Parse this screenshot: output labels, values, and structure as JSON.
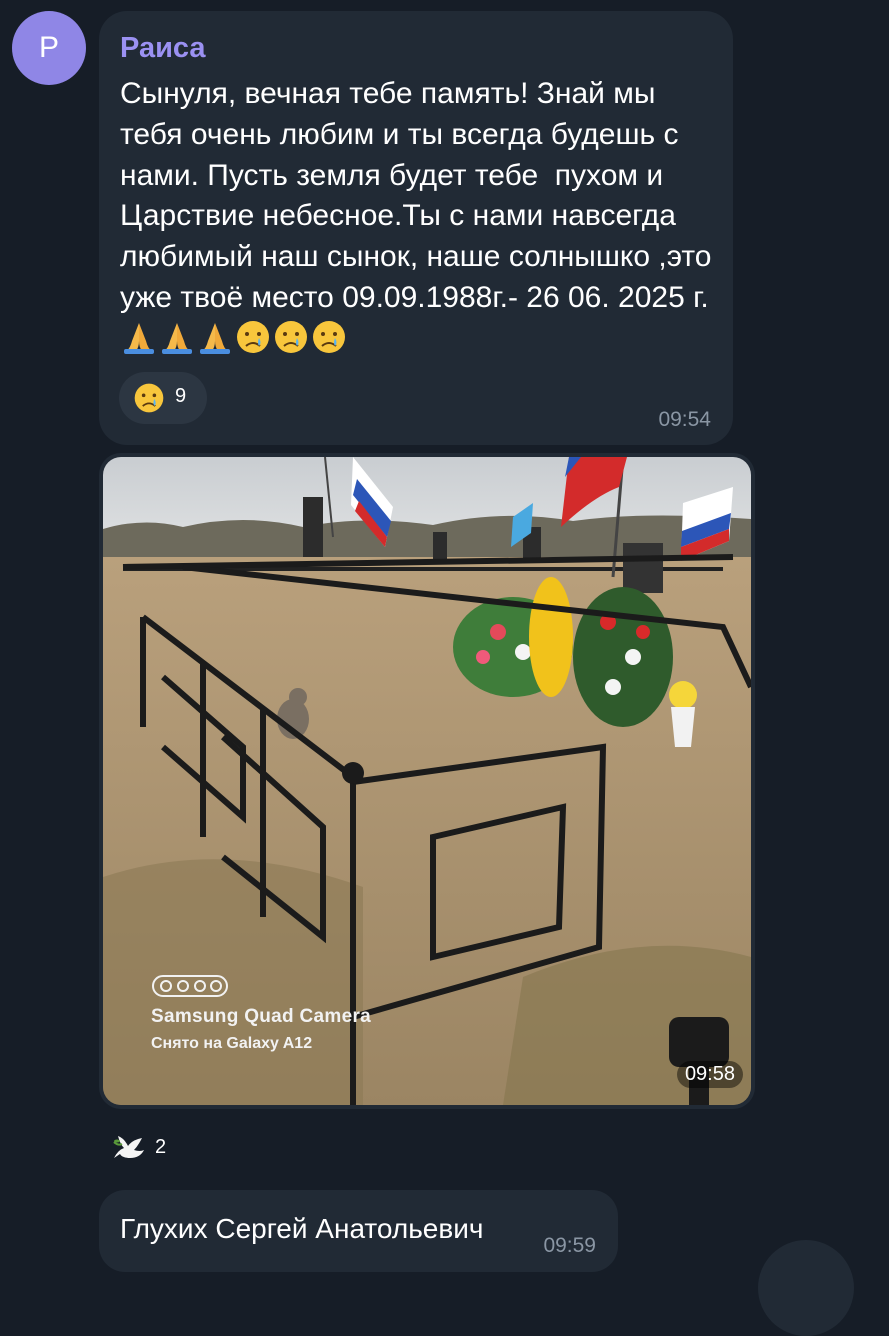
{
  "message1": {
    "avatar_letter": "Р",
    "sender": "Раиса",
    "text": "Сынуля, вечная тебе память! Знай мы тебя очень любим и ты всегда будешь с нами. Пусть земля будет тебе  пухом и Царствие небесное.Ты с нами навсегда любимый наш сынок, наше солнышко ,это уже твоё место 09.09.1988г.- 26 06. 2025 г.",
    "trailing_emojis": [
      "folded-hands-icon",
      "folded-hands-icon",
      "folded-hands-icon",
      "crying-face-icon",
      "crying-face-icon",
      "crying-face-icon"
    ],
    "reaction": {
      "icon": "crying-face-icon",
      "count": "9"
    },
    "time": "09:54"
  },
  "message2": {
    "type": "photo",
    "camera_watermark_line1": "Samsung Quad Camera",
    "camera_watermark_line2": "Снято на Galaxy A12",
    "time": "09:58",
    "reaction": {
      "icon": "dove-icon",
      "count": "2"
    }
  },
  "message3": {
    "text": "Глухих Сергей Анатольевич",
    "time": "09:59"
  },
  "colors": {
    "background": "#161d27",
    "bubble": "#212a35",
    "sender_name": "#9b91f2",
    "avatar": "#8f86e6",
    "timestamp": "#8a96a4"
  }
}
